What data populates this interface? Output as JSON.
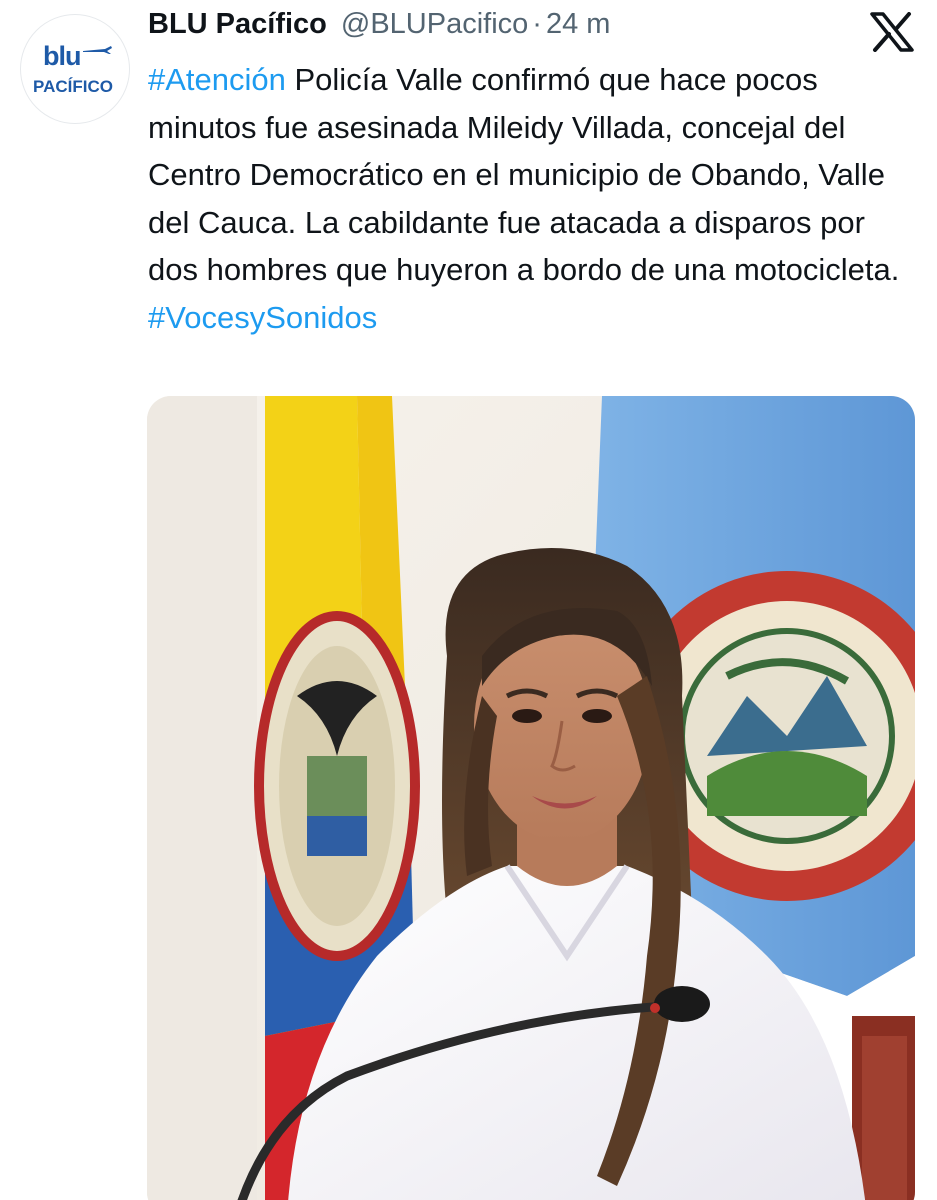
{
  "tweet": {
    "display_name": "BLU Pacífico",
    "handle": "@BLUPacifico",
    "separator": "·",
    "time": "24 m",
    "avatar": {
      "logo_top": "blu",
      "logo_bottom": "PACÍFICO"
    },
    "platform_icon": "x-logo-icon",
    "body": {
      "hashtag_1": "#Atención",
      "text": " Policía Valle confirmó que hace pocos minutos fue asesinada Mileidy Villada, concejal del Centro Democrático en el municipio de Obando, Valle del Cauca. La cabildante fue atacada a disparos por dos hombres que huyeron a bordo de una motocicleta. ",
      "hashtag_2": "#VocesySonidos"
    },
    "media": {
      "type": "photo",
      "description_icon": "photo-icon"
    }
  },
  "colors": {
    "text": "#0f1419",
    "secondary": "#536471",
    "link": "#1d9bf0",
    "brand": "#1e5aa7"
  }
}
